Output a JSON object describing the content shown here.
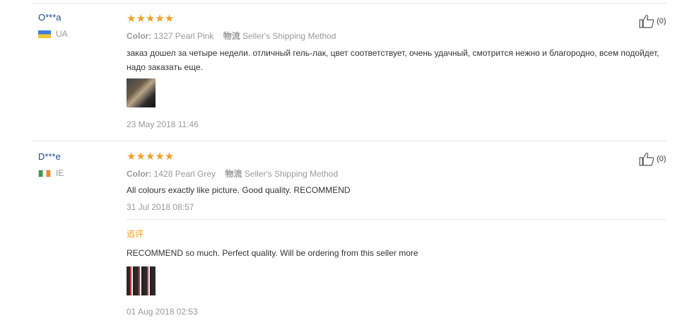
{
  "reviews": [
    {
      "user": "O***a",
      "country": "UA",
      "stars": "★★★★★",
      "color_label": "Color:",
      "color_value": "1327 Pearl Pink",
      "shipping_cn": "物流",
      "shipping_method": "Seller's Shipping Method",
      "text": "заказ дошел за четыре недели. отличный гель-лак, цвет соответствует, очень удачный, смотрится нежно и благородно, всем подойдет, надо заказать еще.",
      "date": "23 May 2018 11:46",
      "likes": "(0)"
    },
    {
      "user": "D***e",
      "country": "IE",
      "stars": "★★★★★",
      "color_label": "Color:",
      "color_value": "1428 Pearl Grey",
      "shipping_cn": "物流",
      "shipping_method": "Seller's Shipping Method",
      "text": "All colours exactly like picture. Good quality. RECOMMEND",
      "date": "31 Jul 2018 08:57",
      "likes": "(0)",
      "followup": {
        "label": "追评",
        "text": "RECOMMEND so much. Perfect quality. Will be ordering from this seller more",
        "date": "01 Aug 2018 02:53"
      }
    }
  ],
  "colors": {
    "star": "#f1a027",
    "username": "#1a4a8c",
    "followup": "#f39a1c"
  },
  "icons": {
    "like": "thumbs-up-icon"
  }
}
